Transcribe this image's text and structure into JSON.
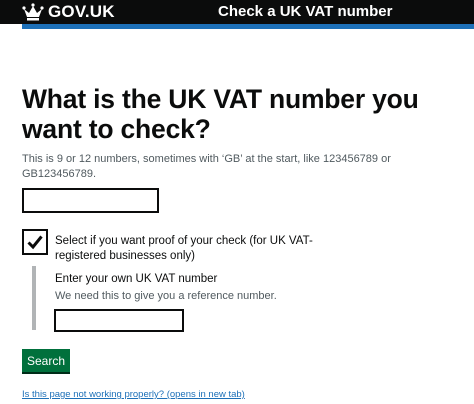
{
  "header": {
    "logo_text": "GOV.UK",
    "service_name": "Check a UK VAT number",
    "background": "#0b0c0c",
    "accent": "#1d70b8"
  },
  "main": {
    "heading": "What is the UK VAT number you want to check?",
    "hint": "This is 9 or 12 numbers, sometimes with ‘GB’ at the start, like 123456789 or GB123456789.",
    "vat_input_value": "",
    "proof_checkbox": {
      "checked": true,
      "label": "Select if you want proof of your check (for UK VAT-registered businesses only)"
    },
    "reference": {
      "label": "Enter your own UK VAT number",
      "hint": "We need this to give you a reference number.",
      "value": ""
    },
    "search_button": "Search",
    "button_color": "#00703c",
    "feedback_link": "Is this page not working properly? (opens in new tab)"
  }
}
